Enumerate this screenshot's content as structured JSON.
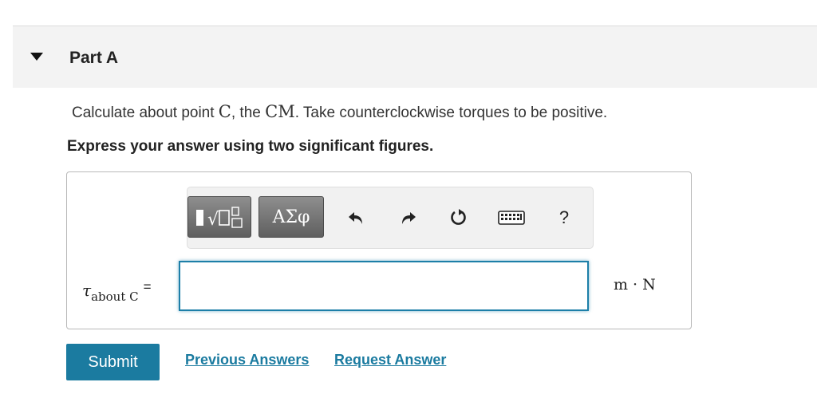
{
  "part": {
    "title": "Part A"
  },
  "question": {
    "prefix": "Calculate about point ",
    "point": "C",
    "mid": ", the ",
    "cm": "CM",
    "suffix": ". Take counterclockwise torques to be positive."
  },
  "instruction": "Express your answer using two significant figures.",
  "toolbar": {
    "greek_label": "ΑΣφ",
    "help_label": "?",
    "icons": [
      "templates-icon",
      "undo-icon",
      "redo-icon",
      "reset-icon",
      "keyboard-icon",
      "help-icon"
    ]
  },
  "answer": {
    "symbol": "τ",
    "subscript": "about C",
    "equals": "=",
    "value": "",
    "units": "m · N"
  },
  "actions": {
    "submit_label": "Submit",
    "previous_answers": "Previous Answers",
    "request_answer": "Request Answer"
  },
  "colors": {
    "accent": "#1b7ba0",
    "header_bg": "#f3f3f3"
  }
}
